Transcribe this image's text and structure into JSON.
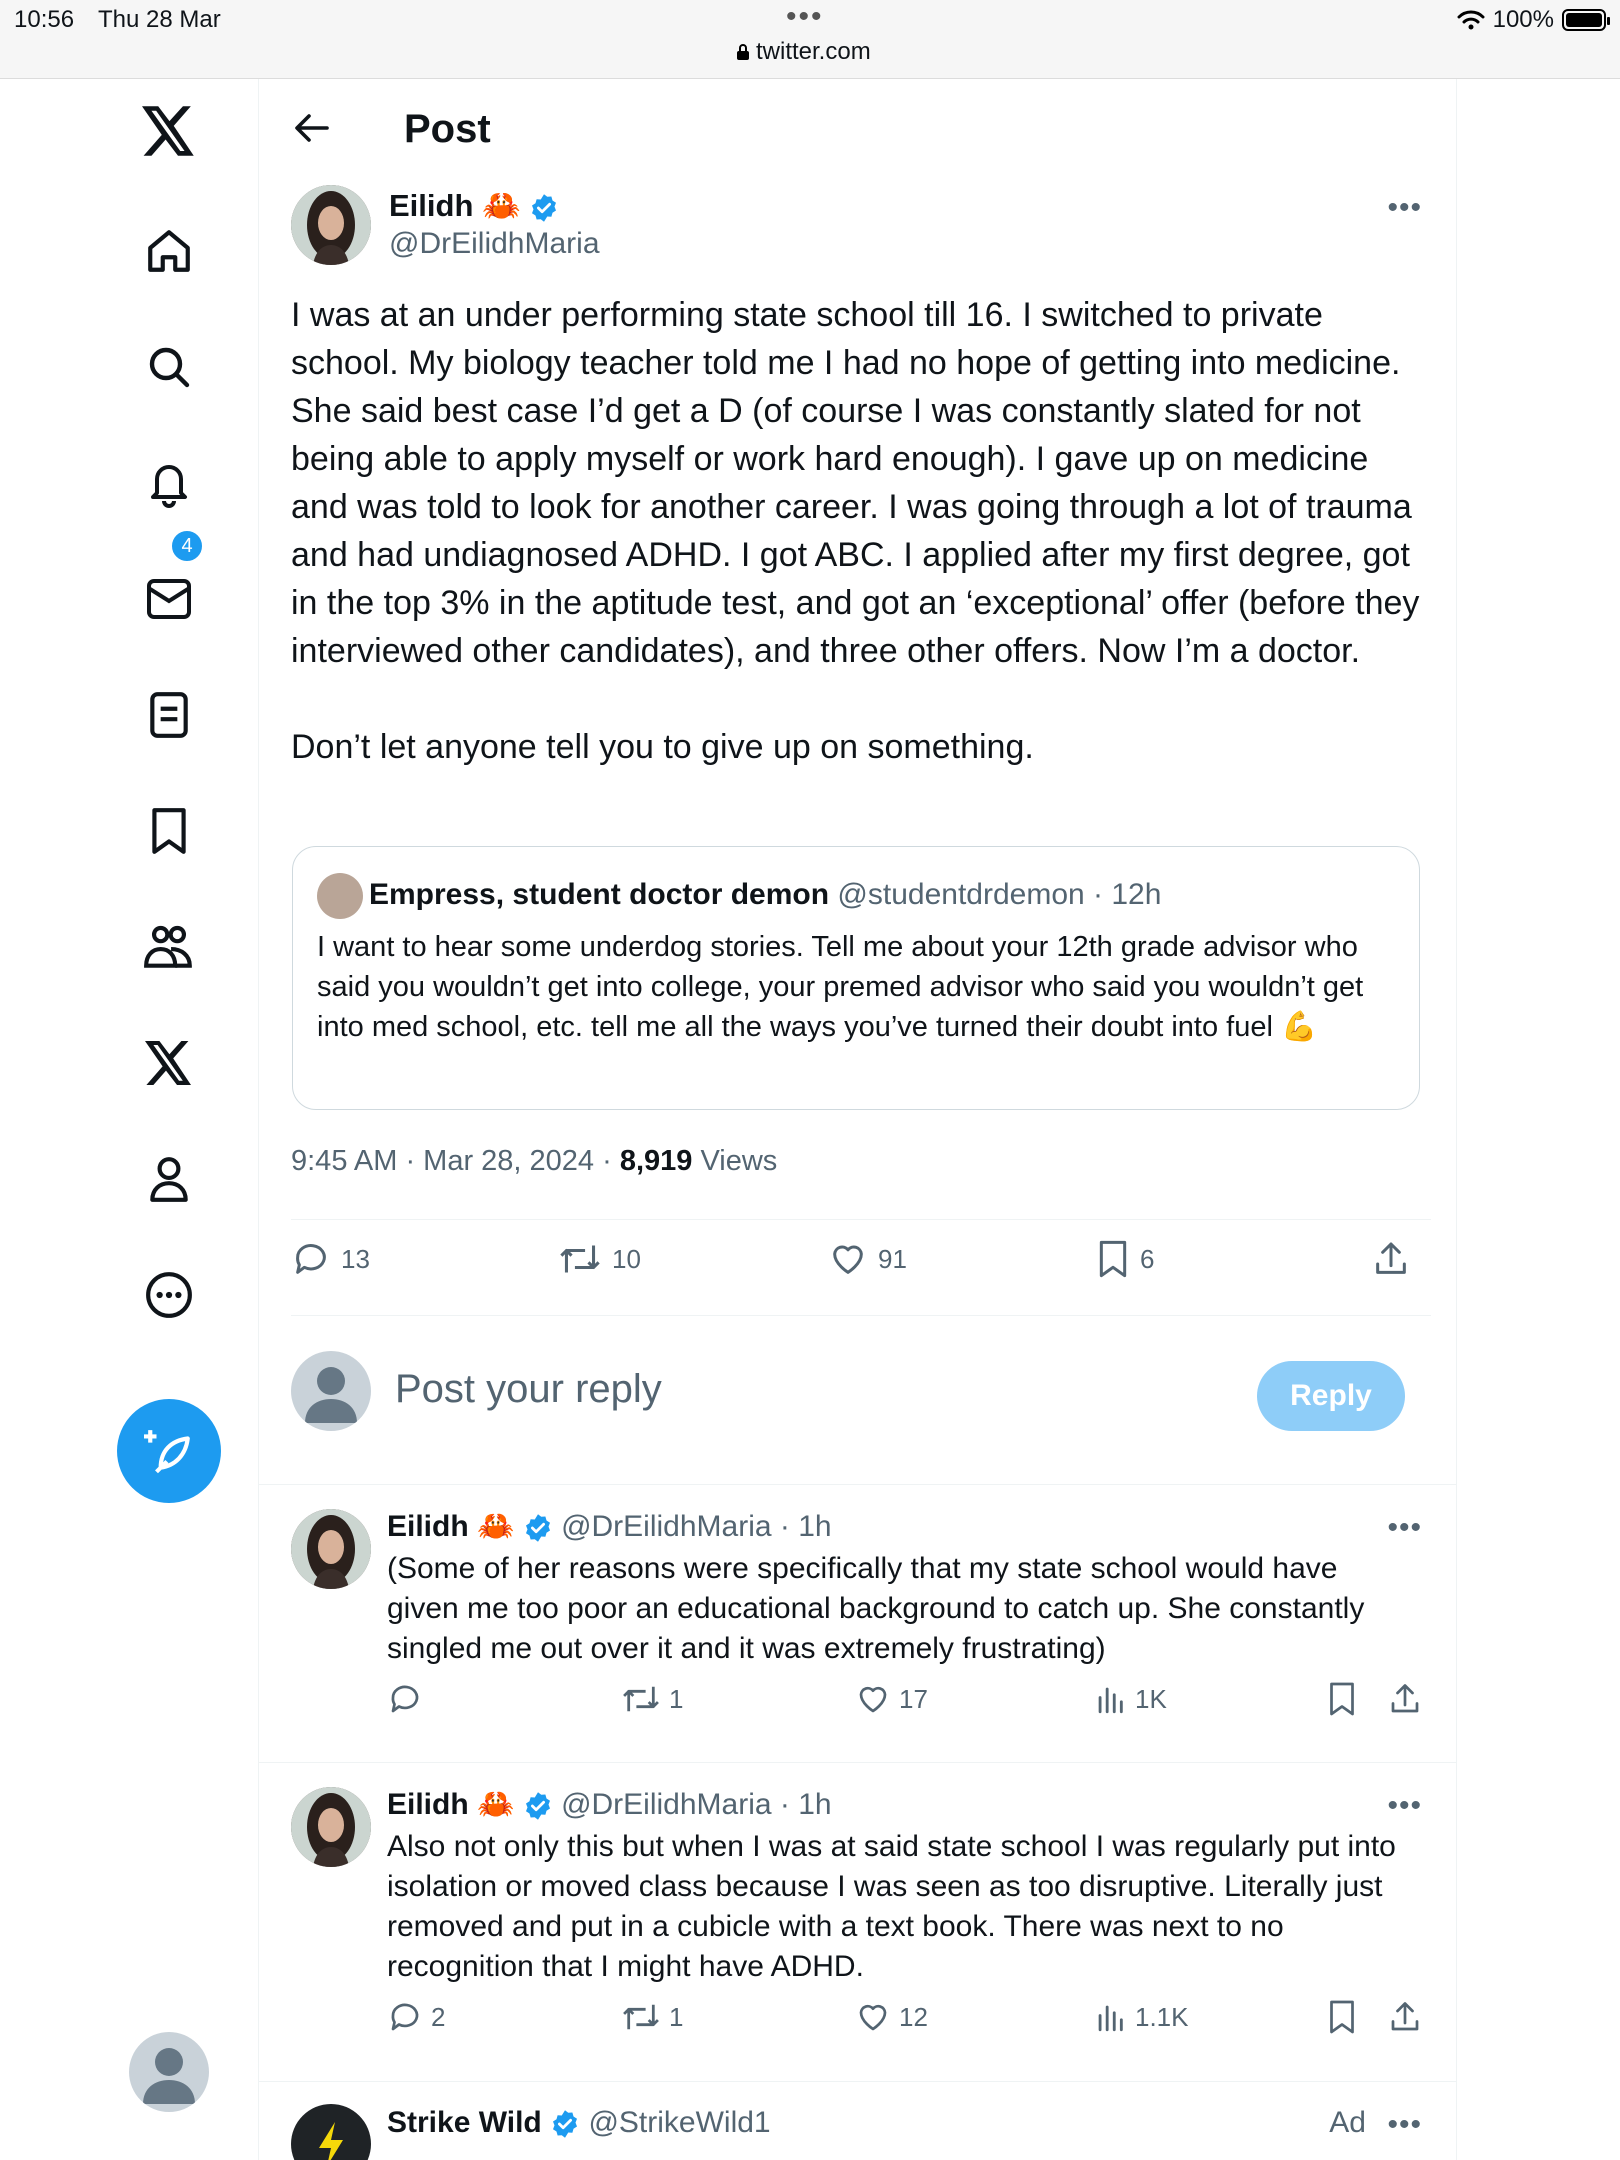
{
  "status_bar": {
    "time": "10:56",
    "date": "Thu 28 Mar",
    "url": "twitter.com",
    "battery": "100%"
  },
  "sidebar": {
    "notification_count": "4"
  },
  "header": {
    "title": "Post"
  },
  "post": {
    "author_name": "Eilidh",
    "author_emoji": "🦀",
    "author_handle": "@DrEilidhMaria",
    "paragraph_1": "I was at an under performing state school till 16. I switched to private school. My biology teacher told me I had no hope of getting into medicine. She said best case I’d get a D (of course I was constantly slated for not being able to apply myself or work hard enough). I gave up on medicine and was told to look for another career. I was going through a lot of trauma and had undiagnosed ADHD. I got ABC. I applied after my first degree, got in the top 3% in the aptitude test, and got an ‘exceptional’ offer (before they interviewed other candidates), and three other offers. Now I’m a doctor.",
    "paragraph_2": "Don’t let anyone tell you to give up on something.",
    "quote": {
      "author_name": "Empress, student doctor demon",
      "author_handle": "@studentdrdemon",
      "time": "· 12h",
      "text": "I want to hear some underdog stories. Tell me about your 12th grade advisor who said you wouldn’t get into college, your premed advisor who said you wouldn’t get into med school, etc. tell me all the ways you’ve turned their doubt into fuel 💪"
    },
    "timestamp": "9:45 AM · Mar 28, 2024 · ",
    "views_count": "8,919",
    "views_label": " Views",
    "replies": "13",
    "reposts": "10",
    "likes": "91",
    "bookmarks": "6"
  },
  "reply_composer": {
    "placeholder": "Post your reply",
    "button_label": "Reply"
  },
  "replies": [
    {
      "author_name": "Eilidh",
      "author_emoji": "🦀",
      "author_handle": "@DrEilidhMaria",
      "time": "· 1h",
      "text": "(Some of her reasons were specifically that my state school would have given me too poor an educational background to catch up. She constantly singled me out over it and it was extremely frustrating)",
      "replies": "",
      "reposts": "1",
      "likes": "17",
      "views": "1K"
    },
    {
      "author_name": "Eilidh",
      "author_emoji": "🦀",
      "author_handle": "@DrEilidhMaria",
      "time": "· 1h",
      "text": "Also not only this but when I was at said state school I was regularly put into isolation or moved class because I was seen as too disruptive. Literally just removed and put in a cubicle with a text book. There was next to no recognition that I might have ADHD.",
      "replies": "2",
      "reposts": "1",
      "likes": "12",
      "views": "1.1K"
    }
  ],
  "ad": {
    "author_name": "Strike Wild",
    "author_handle": "@StrikeWild1",
    "label": "Ad"
  },
  "colors": {
    "accent": "#1d9bf0",
    "text": "#0f1419",
    "muted": "#536471"
  }
}
